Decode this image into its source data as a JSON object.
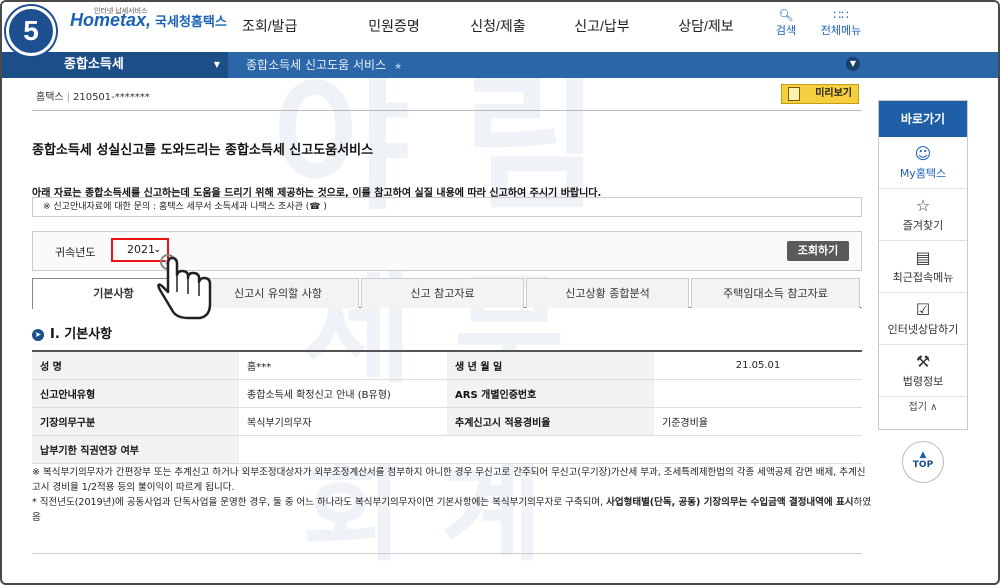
{
  "step_badge": "5",
  "logo": {
    "tiny": "인터넷 납세서비스",
    "brand": "Hometax,",
    "brand2": "국세청홈택스"
  },
  "gnb": [
    "조회/발급",
    "민원증명",
    "신청/제출",
    "신고/납부",
    "상담/제보"
  ],
  "top_icons": {
    "search": "검색",
    "menu": "전체메뉴"
  },
  "nav": {
    "left": "종합소득세",
    "crumb": "종합소득세 신고도움 서비스"
  },
  "hometax_line": {
    "label": "홈택스",
    "id": "210501-*******"
  },
  "preview_btn": "미리보기",
  "title": "종합소득세 성실신고를 도와드리는 종합소득세 신고도움서비스",
  "notice1": "아래 자료는 종합소득세를 신고하는데 도움을 드리기 위해 제공하는 것으로, 이를 참고하여 실질 내용에 따라 신고하여 주시기 바랍니다.",
  "notice2": "※ 신고안내자료에 대한 문의 : 홈택스 세무서 소득세과  나택스 조사관 (☎                    )",
  "search": {
    "label": "귀속년도",
    "year": "2021",
    "query_btn": "조회하기"
  },
  "tabs": [
    "기본사항",
    "신고시 유의할 사항",
    "신고 참고자료",
    "신고상황 종합분석",
    "주택임대소득 참고자료"
  ],
  "section_title": "Ⅰ. 기본사항",
  "table": {
    "r1": {
      "h1": "성          명",
      "v1": "홈***",
      "h2": "생  년  월  일",
      "v2": "21.05.01"
    },
    "r2": {
      "h1": "신고안내유형",
      "v1": "종합소득세 확정신고 안내 (B유형)",
      "h2": "ARS 개별인증번호",
      "v2": ""
    },
    "r3": {
      "h1": "기장의무구분",
      "v1": "복식부기의무자",
      "h2": "추계신고시 적용경비율",
      "v2": "기준경비율"
    },
    "r4": {
      "h1": "납부기한 직권연장 여부",
      "v1": ""
    }
  },
  "notes": {
    "n1": "※ 복식부기의무자가 간편장부 또는 추계신고 하거나 외부조정대상자가 외부조정계산서를 첨부하지 아니한 경우 무신고로 간주되어 무신고(무기장)가산세 부과, 조세특례제한법의 각종 세액공제 감면 배제, 추계신고시 경비율 1/2적용 등의 불이익이 따르게 됩니다.",
    "n2a": "* 직전년도(2019년)에 공동사업과 단독사업을 운영한 경우, 둘 중 어느 하나라도 복식부기의무자이면 기본사항에는 복식부기의무자로 구축되며, ",
    "n2b": "사업형태별(단독, 공동) 기장의무는 수입금액 결정내역에 표시",
    "n2c": "하였음"
  },
  "quick": {
    "head": "바로가기",
    "items": [
      "My홈택스",
      "즐겨찾기",
      "최근접속메뉴",
      "인터넷상담하기",
      "법령정보"
    ],
    "fold": "접기 ∧"
  },
  "top_btn": "TOP",
  "colors": {
    "brand_blue": "#1e5fa8",
    "nav_blue": "#2b67a8",
    "highlight_red": "#ee1111",
    "preview_yellow": "#f6cf3f"
  }
}
